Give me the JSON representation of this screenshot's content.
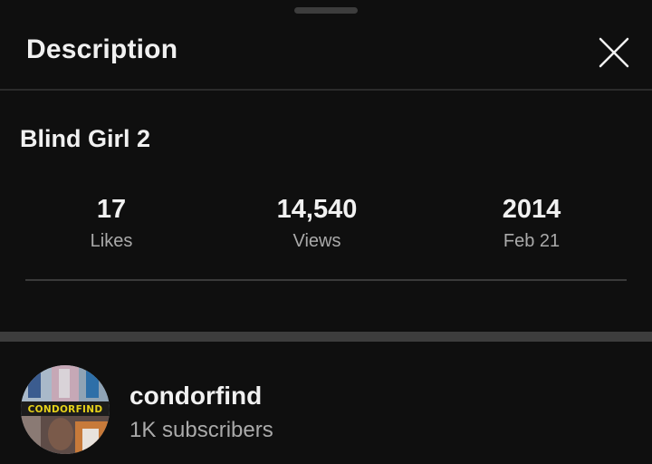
{
  "header": {
    "title": "Description",
    "close_icon": "close-icon"
  },
  "video": {
    "title": "Blind Girl 2"
  },
  "stats": {
    "likes": {
      "value": "17",
      "label": "Likes"
    },
    "views": {
      "value": "14,540",
      "label": "Views"
    },
    "date": {
      "value": "2014",
      "label": "Feb 21"
    }
  },
  "channel": {
    "name": "condorfind",
    "subscribers": "1K subscribers",
    "avatar_text": "CONDORFIND",
    "avatar_icon": "channel-avatar"
  },
  "colors": {
    "background": "#0f0f0f",
    "text_primary": "#f1f1f1",
    "text_secondary": "#aaaaaa",
    "divider": "#3a3a3a",
    "avatar_banner_text": "#e6d21a"
  }
}
